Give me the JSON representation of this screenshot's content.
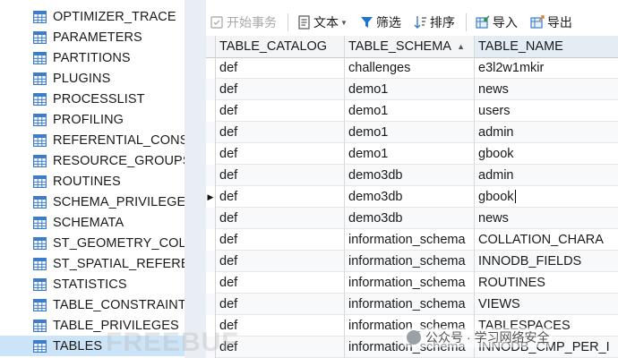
{
  "tree": {
    "items": [
      {
        "label": "OPTIMIZER_TRACE",
        "selected": false
      },
      {
        "label": "PARAMETERS",
        "selected": false
      },
      {
        "label": "PARTITIONS",
        "selected": false
      },
      {
        "label": "PLUGINS",
        "selected": false
      },
      {
        "label": "PROCESSLIST",
        "selected": false
      },
      {
        "label": "PROFILING",
        "selected": false
      },
      {
        "label": "REFERENTIAL_CONST",
        "selected": false
      },
      {
        "label": "RESOURCE_GROUPS",
        "selected": false
      },
      {
        "label": "ROUTINES",
        "selected": false
      },
      {
        "label": "SCHEMA_PRIVILEGES",
        "selected": false
      },
      {
        "label": "SCHEMATA",
        "selected": false
      },
      {
        "label": "ST_GEOMETRY_COLU",
        "selected": false
      },
      {
        "label": "ST_SPATIAL_REFEREN",
        "selected": false
      },
      {
        "label": "STATISTICS",
        "selected": false
      },
      {
        "label": "TABLE_CONSTRAINT",
        "selected": false
      },
      {
        "label": "TABLE_PRIVILEGES",
        "selected": false
      },
      {
        "label": "TABLES",
        "selected": true
      }
    ]
  },
  "toolbar": {
    "begin_transaction": "开始事务",
    "text": "文本",
    "filter": "筛选",
    "sort": "排序",
    "import": "导入",
    "export": "导出"
  },
  "grid": {
    "columns": [
      "TABLE_CATALOG",
      "TABLE_SCHEMA",
      "TABLE_NAME"
    ],
    "rows": [
      [
        "def",
        "challenges",
        "e3l2w1mkir"
      ],
      [
        "def",
        "demo1",
        "news"
      ],
      [
        "def",
        "demo1",
        "users"
      ],
      [
        "def",
        "demo1",
        "admin"
      ],
      [
        "def",
        "demo1",
        "gbook"
      ],
      [
        "def",
        "demo3db",
        "admin"
      ],
      [
        "def",
        "demo3db",
        "gbook"
      ],
      [
        "def",
        "demo3db",
        "news"
      ],
      [
        "def",
        "information_schema",
        "COLLATION_CHARA"
      ],
      [
        "def",
        "information_schema",
        "INNODB_FIELDS"
      ],
      [
        "def",
        "information_schema",
        "ROUTINES"
      ],
      [
        "def",
        "information_schema",
        "VIEWS"
      ],
      [
        "def",
        "information_schema",
        "TABLESPACES"
      ],
      [
        "def",
        "information_schema",
        "INNODB_CMP_PER_I"
      ]
    ],
    "current_row": 6,
    "sorted_column": 1
  },
  "watermark": {
    "left": "FREEBUF",
    "right": "公众号 · 学习网络安全"
  },
  "colors": {
    "selection": "#cce4f7",
    "icon_blue": "#3d7cc9",
    "filter_blue": "#1f73d1"
  }
}
